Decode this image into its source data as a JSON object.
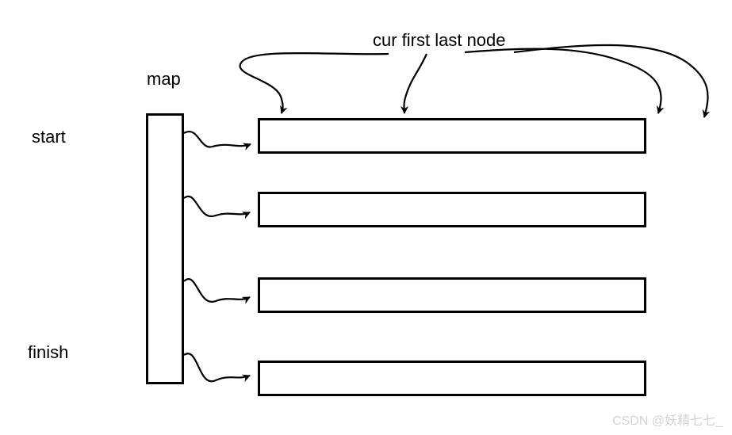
{
  "labels": {
    "map": "map",
    "start": "start",
    "finish": "finish",
    "header": "cur first last node"
  },
  "watermark": "CSDN @妖精七七_",
  "rows": {
    "count": 4,
    "tops": [
      149,
      242,
      350,
      455
    ]
  }
}
